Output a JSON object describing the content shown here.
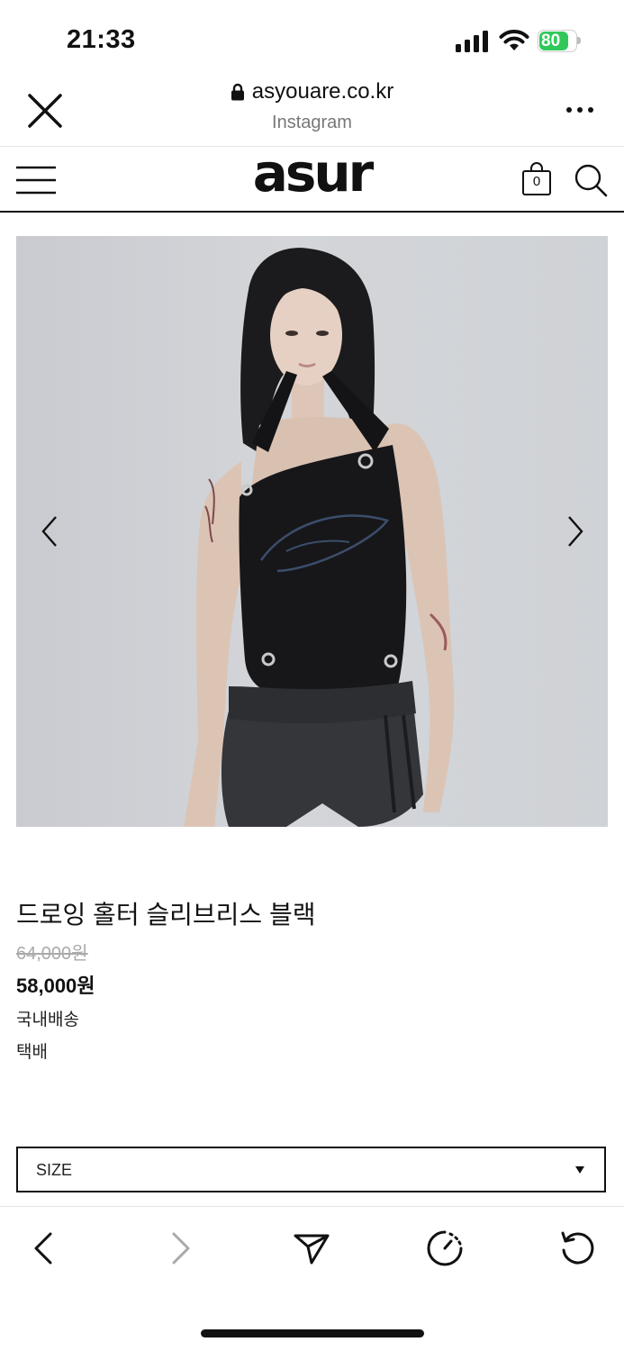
{
  "status_bar": {
    "time": "21:33",
    "battery": "80",
    "battery_level": 0.8
  },
  "browser": {
    "url": "asyouare.co.kr",
    "source": "Instagram"
  },
  "site": {
    "logo": "asur",
    "cart_count": "0"
  },
  "product": {
    "name": "드로잉 홀터 슬리브리스 블랙",
    "original_price": "64,000원",
    "sale_price": "58,000원",
    "shipping_region": "국내배송",
    "shipping_method": "택배"
  },
  "size_select": {
    "label": "SIZE"
  },
  "icons": {
    "close": "close-icon",
    "lock": "lock-icon",
    "more": "more-icon",
    "menu": "hamburger-icon",
    "cart": "shopping-bag-icon",
    "search": "search-icon",
    "prev_image": "chevron-left-icon",
    "next_image": "chevron-right-icon",
    "back": "back-icon",
    "forward": "forward-icon",
    "share": "send-icon",
    "history": "timer-icon",
    "reload": "reload-icon"
  },
  "colors": {
    "battery": "#32c859",
    "text": "#111111",
    "muted": "#aaaaaa"
  }
}
